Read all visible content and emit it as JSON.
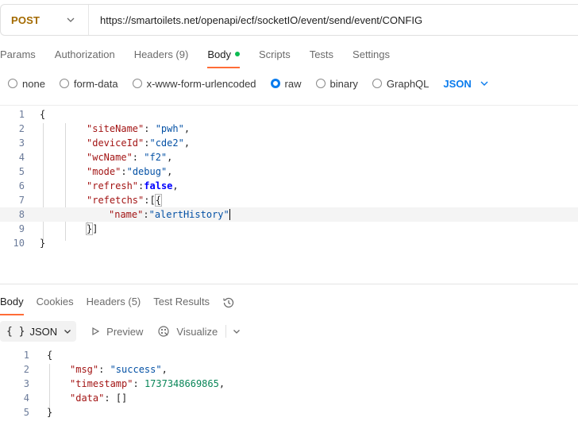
{
  "request": {
    "method": "POST",
    "url": "https://smartoilets.net/openapi/ecf/socketIO/event/send/event/CONFIG"
  },
  "request_tabs": [
    {
      "label": "Params"
    },
    {
      "label": "Authorization"
    },
    {
      "label": "Headers (9)"
    },
    {
      "label": "Body"
    },
    {
      "label": "Scripts"
    },
    {
      "label": "Tests"
    },
    {
      "label": "Settings"
    }
  ],
  "body_options": [
    {
      "label": "none"
    },
    {
      "label": "form-data"
    },
    {
      "label": "x-www-form-urlencoded"
    },
    {
      "label": "raw"
    },
    {
      "label": "binary"
    },
    {
      "label": "GraphQL"
    }
  ],
  "body_format": "JSON",
  "editor_lines": {
    "l1": "1",
    "l2": "2",
    "l3": "3",
    "l4": "4",
    "l5": "5",
    "l6": "6",
    "l7": "7",
    "l8": "8",
    "l9": "9",
    "l10": "10"
  },
  "request_body": {
    "k_siteName": "\"siteName\"",
    "v_siteName": "\"pwh\"",
    "k_deviceId": "\"deviceId\"",
    "v_deviceId": "\"cde2\"",
    "k_wcName": "\"wcName\"",
    "v_wcName": "\"f2\"",
    "k_mode": "\"mode\"",
    "v_mode": "\"debug\"",
    "k_refresh": "\"refresh\"",
    "v_refresh": "false",
    "k_refetchs": "\"refetchs\"",
    "k_name": "\"name\"",
    "v_name": "\"alertHistory\""
  },
  "response_tabs": [
    {
      "label": "Body"
    },
    {
      "label": "Cookies"
    },
    {
      "label": "Headers (5)"
    },
    {
      "label": "Test Results"
    }
  ],
  "response_toolbar": {
    "format_label": "JSON",
    "braces": "{ }",
    "preview_label": "Preview",
    "visualize_label": "Visualize"
  },
  "response_lines": {
    "l1": "1",
    "l2": "2",
    "l3": "3",
    "l4": "4",
    "l5": "5"
  },
  "response_body": {
    "k_msg": "\"msg\"",
    "v_msg": "\"success\"",
    "k_timestamp": "\"timestamp\"",
    "v_timestamp": "1737348669865",
    "k_data": "\"data\"",
    "v_data": "[]"
  },
  "colors": {
    "method": "#a36a00",
    "active_tab_underline": "#ff6c37",
    "body_dot": "#0cbb52",
    "accent_blue": "#097bed"
  }
}
